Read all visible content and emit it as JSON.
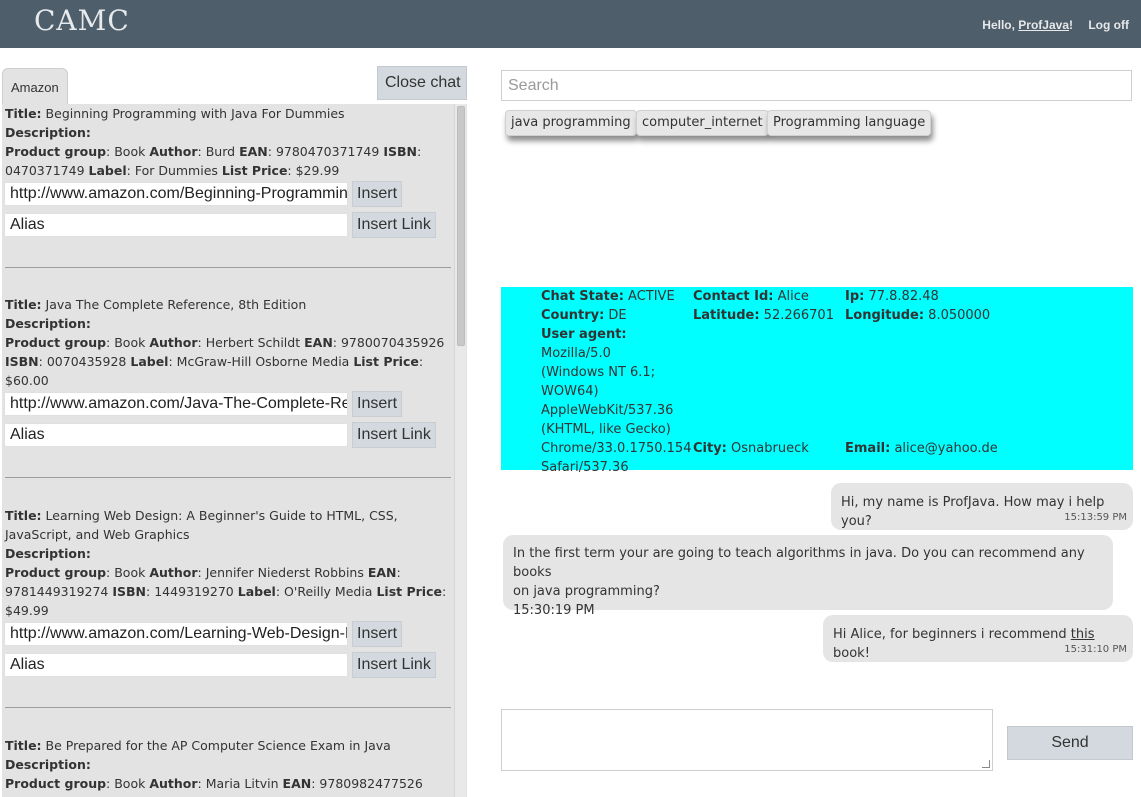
{
  "header": {
    "brand": "CAMC",
    "hello_prefix": "Hello, ",
    "user_name": "ProfJava",
    "hello_suffix": "!",
    "logoff": "Log off"
  },
  "left": {
    "tab": "Amazon",
    "close_chat": "Close chat",
    "insert_label": "Insert",
    "insert_link_label": "Insert Link",
    "alias_placeholder": "Alias",
    "labels": {
      "title": "Title:",
      "description": "Description:",
      "product_group": "Product group",
      "author": "Author",
      "ean": "EAN",
      "isbn": "ISBN",
      "label": "Label",
      "list_price": "List Price"
    },
    "products": [
      {
        "title": "Beginning Programming with Java For Dummies",
        "group": "Book",
        "author": "Burd",
        "ean": "9780470371749",
        "isbn": "0470371749",
        "label": "For Dummies",
        "price": "$29.99",
        "url": "http://www.amazon.com/Beginning-Programming-with-Java-Dummies"
      },
      {
        "title": "Java The Complete Reference, 8th Edition",
        "group": "Book",
        "author": "Herbert Schildt",
        "ean": "9780070435926",
        "isbn": "0070435928",
        "label": "McGraw-Hill Osborne Media",
        "price": "$60.00",
        "url": "http://www.amazon.com/Java-The-Complete-Reference"
      },
      {
        "title": "Learning Web Design: A Beginner's Guide to HTML, CSS, JavaScript, and Web Graphics",
        "group": "Book",
        "author": "Jennifer Niederst Robbins",
        "ean": "9781449319274",
        "isbn": "1449319270",
        "label": "O'Reilly Media",
        "price": "$49.99",
        "url": "http://www.amazon.com/Learning-Web-Design-Beginners"
      },
      {
        "title": "Be Prepared for the AP Computer Science Exam in Java",
        "group": "Book",
        "author": "Maria Litvin",
        "ean": "9780982477526"
      }
    ]
  },
  "search": {
    "placeholder": "Search"
  },
  "tags": [
    "java programming",
    "computer_internet",
    "Programming language"
  ],
  "info": {
    "chat_state_label": "Chat State:",
    "chat_state": "ACTIVE",
    "contact_id_label": "Contact Id:",
    "contact_id": "Alice",
    "ip_label": "Ip:",
    "ip": "77.8.82.48",
    "country_label": "Country:",
    "country": "DE",
    "latitude_label": "Latitude:",
    "latitude": "52.266701",
    "longitude_label": "Longitude:",
    "longitude": "8.050000",
    "user_agent_label": "User agent:",
    "user_agent_lines": [
      "Mozilla/5.0",
      "(Windows NT 6.1;",
      "WOW64)",
      "AppleWebKit/537.36",
      "(KHTML, like Gecko)",
      "Chrome/33.0.1750.154",
      "Safari/537.36"
    ],
    "city_label": "City:",
    "city": "Osnabrueck",
    "email_label": "Email:",
    "email": "alice@yahoo.de"
  },
  "chat": [
    {
      "text": "Hi, my name is ProfJava. How may i help you?",
      "time": "15:13:59 PM"
    },
    {
      "text_line1": "In the first term your are going to teach algorithms in java. Do you can recommend any books",
      "text_line2": "on java programming?",
      "time": "15:30:19 PM"
    },
    {
      "text_before": "Hi Alice, for beginners i recommend ",
      "link": "this",
      "text_after": " book!",
      "time": "15:31:10 PM"
    }
  ],
  "composer": {
    "send_label": "Send"
  }
}
